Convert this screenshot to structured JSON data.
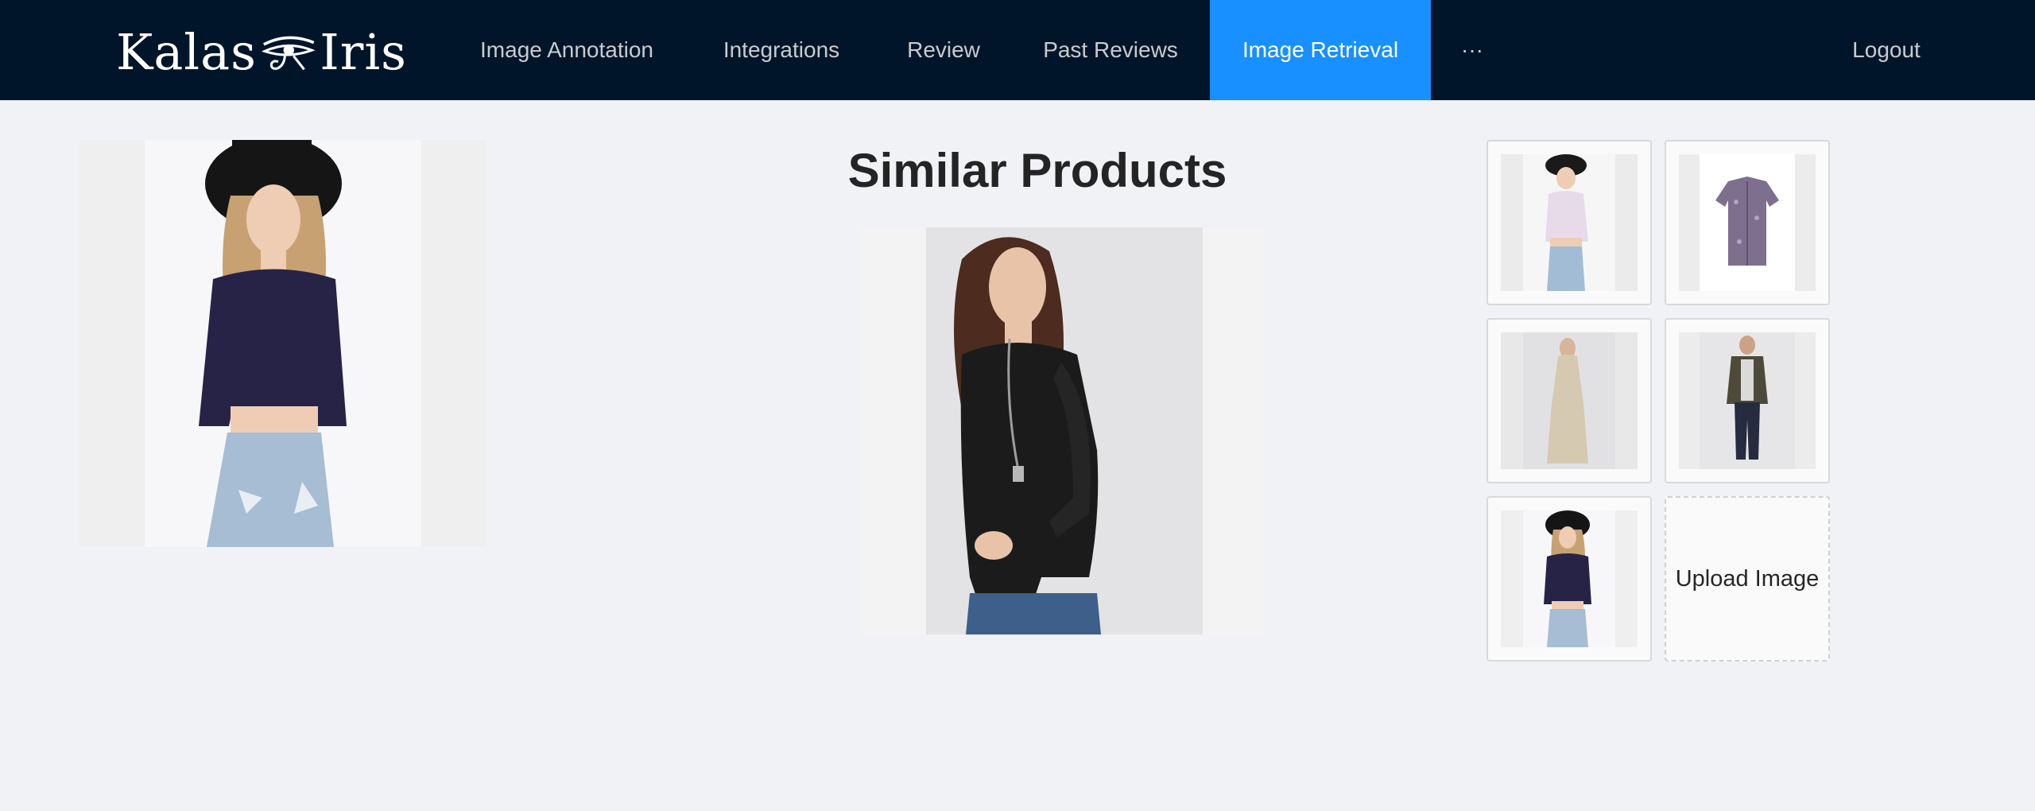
{
  "header": {
    "logo": {
      "left_text": "Kalas",
      "right_text": "Iris",
      "icon": "eye-of-horus-icon"
    },
    "nav": [
      {
        "label": "Image Annotation",
        "active": false
      },
      {
        "label": "Integrations",
        "active": false
      },
      {
        "label": "Review",
        "active": false
      },
      {
        "label": "Past Reviews",
        "active": false
      },
      {
        "label": "Image Retrieval",
        "active": true
      },
      {
        "label": "···",
        "active": false
      }
    ],
    "logout_label": "Logout"
  },
  "main": {
    "query_image": {
      "alt": "woman in black hat, navy lace crop top and ripped light jeans"
    },
    "title": "Similar Products",
    "result_image": {
      "alt": "woman with long brown hair in black lace long-sleeve top and jeans"
    },
    "thumbnails": [
      {
        "alt": "woman in black hat, lilac lace top and jeans"
      },
      {
        "alt": "floral short-sleeve button shirt"
      },
      {
        "alt": "woman in beige lace maxi dress"
      },
      {
        "alt": "man in olive bomber jacket and jeans"
      },
      {
        "alt": "woman in black hat, navy lace crop top and jeans"
      }
    ],
    "upload_label": "Upload Image"
  },
  "colors": {
    "header_bg": "#001529",
    "active_tab": "#1890ff",
    "page_bg": "#f0f2f5"
  }
}
